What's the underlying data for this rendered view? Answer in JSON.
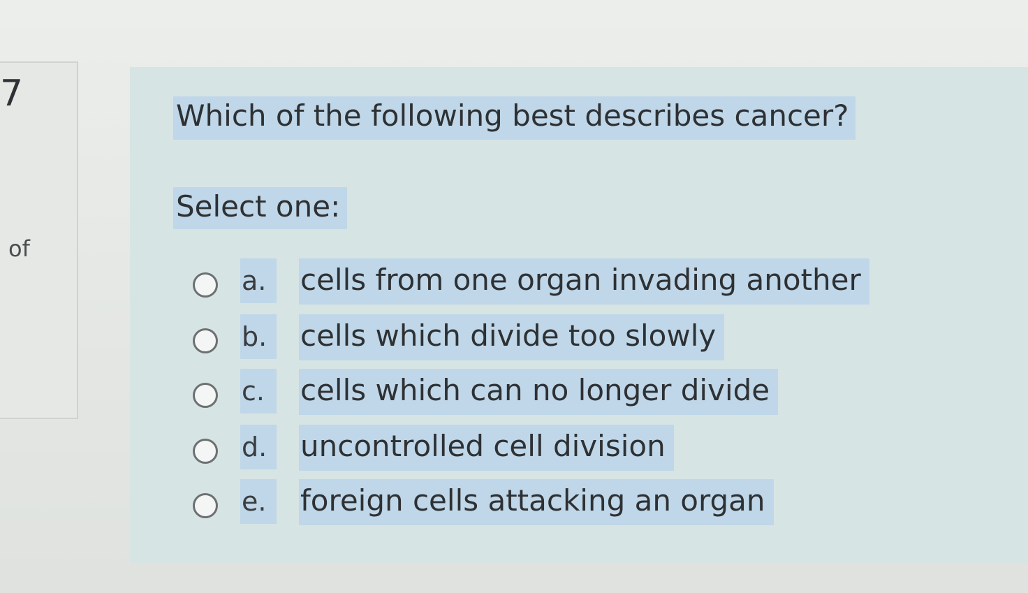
{
  "sidebar": {
    "question_number": "7",
    "of_label": "of"
  },
  "question": {
    "text": "Which of the following best describes cancer?",
    "prompt": "Select one:",
    "options": [
      {
        "letter": "a.",
        "text": "cells from one organ invading another"
      },
      {
        "letter": "b.",
        "text": "cells which divide too slowly"
      },
      {
        "letter": "c.",
        "text": "cells which can no longer divide"
      },
      {
        "letter": "d.",
        "text": "uncontrolled cell division"
      },
      {
        "letter": "e.",
        "text": "foreign cells attacking an organ"
      }
    ]
  },
  "colors": {
    "selection_highlight": "#bfd7e8",
    "panel_background": "#d7e4e4"
  }
}
